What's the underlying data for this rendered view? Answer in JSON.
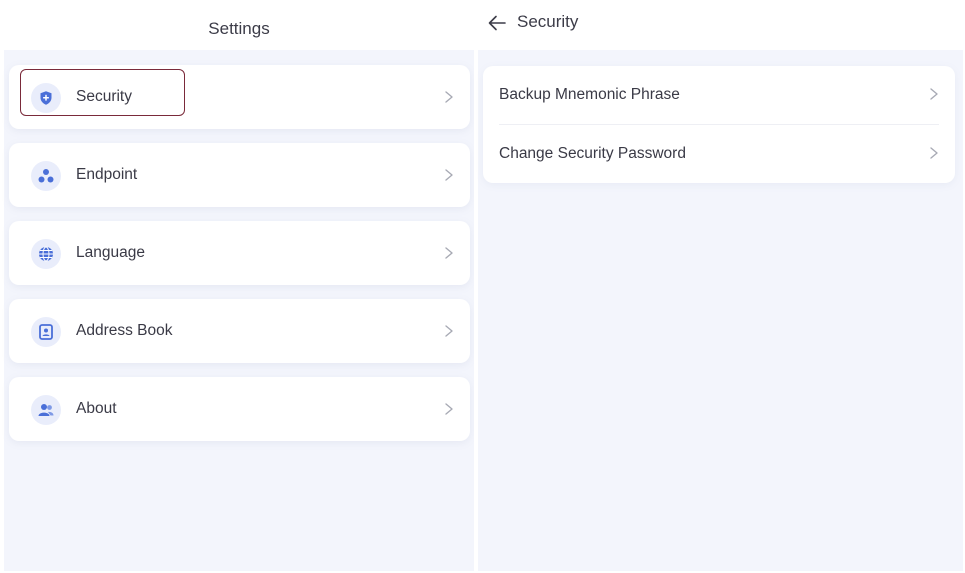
{
  "left_panel": {
    "title": "Settings",
    "items": [
      {
        "label": "Security",
        "icon": "shield-icon"
      },
      {
        "label": "Endpoint",
        "icon": "nodes-icon"
      },
      {
        "label": "Language",
        "icon": "globe-icon"
      },
      {
        "label": "Address Book",
        "icon": "contact-book-icon"
      },
      {
        "label": "About",
        "icon": "users-icon"
      }
    ]
  },
  "right_panel": {
    "title": "Security",
    "items": [
      {
        "label": "Backup Mnemonic Phrase"
      },
      {
        "label": "Change Security Password"
      }
    ]
  },
  "colors": {
    "accent": "#4a6fd8",
    "icon_bg": "#e9edfb",
    "panel_bg": "#f3f5fc",
    "focus_ring": "#7a2a3a"
  }
}
